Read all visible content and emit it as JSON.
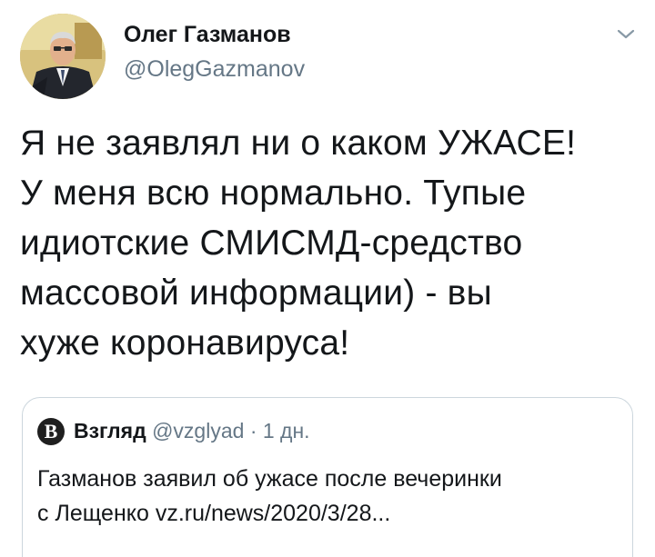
{
  "tweet": {
    "author": {
      "display_name": "Олег Газманов",
      "handle": "@OlegGazmanov",
      "avatar": "author-avatar-photo"
    },
    "menu_icon": "chevron-down-icon",
    "text": "Я не заявлял ни о каком УЖАСЕ!\nУ меня всю нормально. Тупые\nидиотские СМИСМД-средство\nмассовой информации) - вы\nхуже коронавируса!"
  },
  "quoted_tweet": {
    "avatar_letter": "В",
    "name": "Взгляд",
    "handle": "@vzglyad",
    "separator": "·",
    "time": "1 дн.",
    "text": "Газманов заявил об ужасе после вечеринки\nс Лещенко vz.ru/news/2020/3/28..."
  },
  "colors": {
    "primary_text": "#14171a",
    "secondary_text": "#657786",
    "border": "#ccd6dd",
    "background": "#ffffff"
  }
}
